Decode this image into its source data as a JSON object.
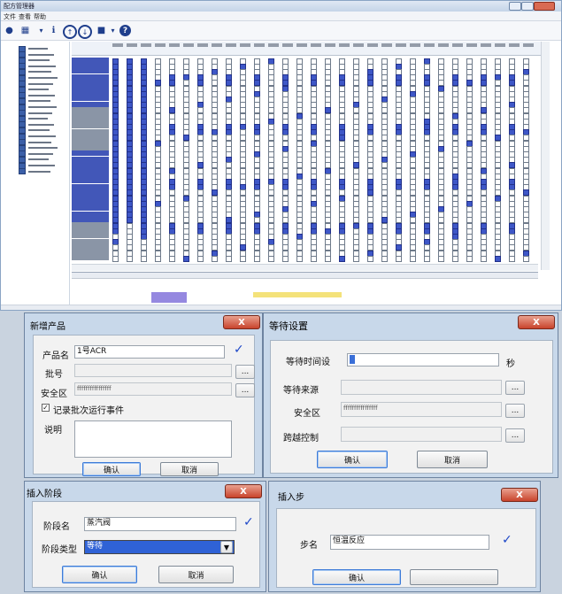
{
  "main_window": {
    "title": "配方管理器",
    "menu": [
      "文件",
      "查看",
      "帮助"
    ]
  },
  "colors": {
    "accent": "#3e57c7",
    "dialog_bg": "#c8d8ea",
    "close": "#c8432b",
    "selection": "#3a6fd8"
  },
  "dlg_new_product": {
    "title": "新增产品",
    "close": "X",
    "product_name_label": "产品名",
    "product_name_value": "1号ACR",
    "batch_label": "批号",
    "safety_zone_label": "安全区",
    "safety_zone_value": "ffffffffffffffff",
    "record_events_label": "记录批次运行事件",
    "description_label": "说明",
    "ok": "确认",
    "cancel": "取消",
    "ellipsis": "..."
  },
  "dlg_wait_settings": {
    "title": "等待设置",
    "close": "X",
    "wait_label": "等待时间设",
    "wait_unit": "秒",
    "wait_source_label": "等待来源",
    "safety_zone_label": "安全区",
    "safety_zone_value": "ffffffffffffffff",
    "skip_control_label": "跨越控制",
    "ok": "确认",
    "cancel": "取消",
    "ellipsis": "..."
  },
  "dlg_insert_stage": {
    "title": "插入阶段",
    "close": "X",
    "stage_name_label": "阶段名",
    "stage_name_value": "蒸汽阀",
    "stage_type_label": "阶段类型",
    "stage_type_value": "等待",
    "ok": "确认",
    "cancel": "取消"
  },
  "dlg_insert_step": {
    "title": "插入步",
    "close": "X",
    "step_name_label": "步名",
    "step_name_value": "恒温反应",
    "ok": "确认"
  }
}
